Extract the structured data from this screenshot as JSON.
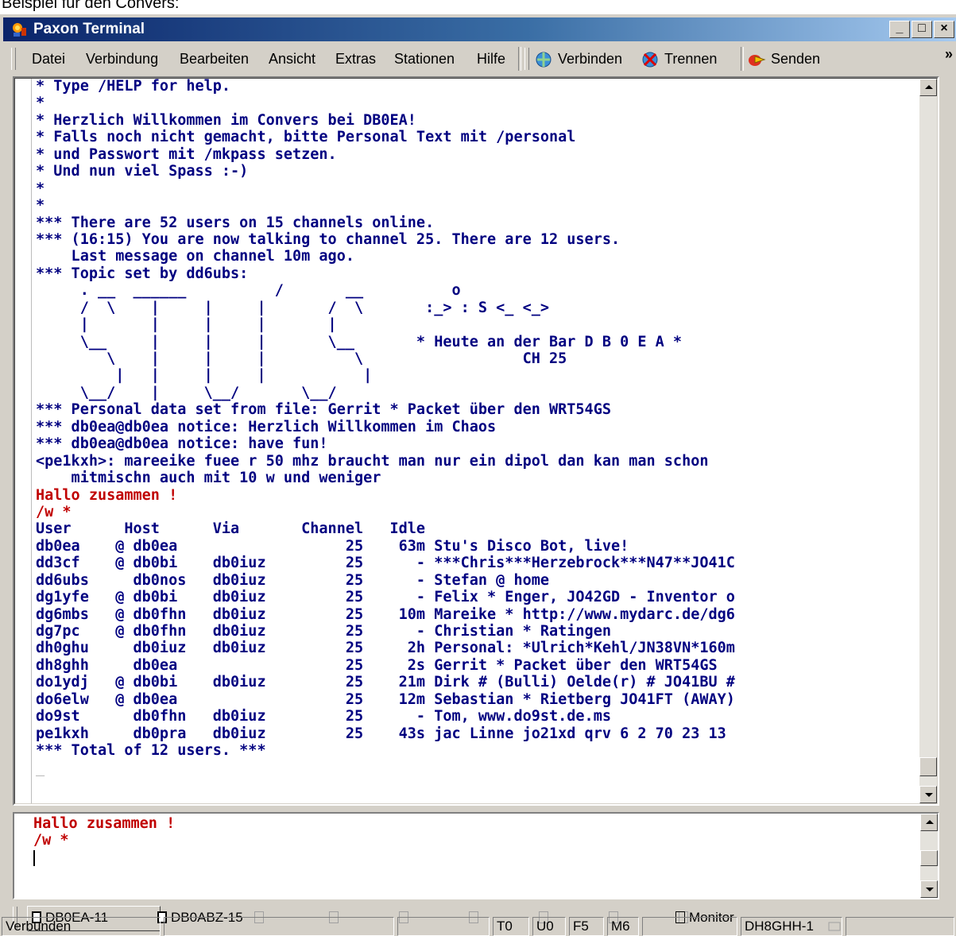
{
  "caption": "Beispiel für den Convers:",
  "window": {
    "title": "Paxon Terminal",
    "buttons": {
      "minimize": "_",
      "maximize": "□",
      "close": "×"
    }
  },
  "menu": {
    "items": [
      {
        "label": "Datei"
      },
      {
        "label": "Verbindung"
      },
      {
        "label": "Bearbeiten"
      },
      {
        "label": "Ansicht"
      },
      {
        "label": "Extras"
      },
      {
        "label": "Stationen"
      },
      {
        "label": "Hilfe"
      }
    ],
    "toolbar": [
      {
        "label": "Verbinden",
        "icon": "connect-icon"
      },
      {
        "label": "Trennen",
        "icon": "disconnect-icon"
      },
      {
        "label": "Senden",
        "icon": "send-icon"
      }
    ],
    "overflow": "»"
  },
  "terminal": {
    "lines": [
      {
        "text": "* Type /HELP for help.",
        "color": "blue"
      },
      {
        "text": "*",
        "color": "blue"
      },
      {
        "text": "* Herzlich Willkommen im Convers bei DB0EA!",
        "color": "blue"
      },
      {
        "text": "* Falls noch nicht gemacht, bitte Personal Text mit /personal",
        "color": "blue"
      },
      {
        "text": "* und Passwort mit /mkpass setzen.",
        "color": "blue"
      },
      {
        "text": "* Und nun viel Spass :-)",
        "color": "blue"
      },
      {
        "text": "*",
        "color": "blue"
      },
      {
        "text": "*",
        "color": "blue"
      },
      {
        "text": "*** There are 52 users on 15 channels online.",
        "color": "blue"
      },
      {
        "text": "*** (16:15) You are now talking to channel 25. There are 12 users.",
        "color": "blue"
      },
      {
        "text": "    Last message on channel 10m ago.",
        "color": "blue"
      },
      {
        "text": "*** Topic set by dd6ubs:",
        "color": "blue"
      },
      {
        "text": "     . __  ______          /       __          o",
        "color": "blue"
      },
      {
        "text": "     /  \\    |     |     |       /  \\       :_> : S <_ <_>",
        "color": "blue"
      },
      {
        "text": "     |       |     |     |       |",
        "color": "blue"
      },
      {
        "text": "     \\__     |     |     |       \\__       * Heute an der Bar D B 0 E A *",
        "color": "blue"
      },
      {
        "text": "        \\    |     |     |          \\                  CH 25",
        "color": "blue"
      },
      {
        "text": "         |   |     |     |           |",
        "color": "blue"
      },
      {
        "text": "     \\__/    |     \\__/       \\__/",
        "color": "blue"
      },
      {
        "text": "*** Personal data set from file: Gerrit * Packet über den WRT54GS",
        "color": "blue"
      },
      {
        "text": "*** db0ea@db0ea notice: Herzlich Willkommen im Chaos",
        "color": "blue"
      },
      {
        "text": "*** db0ea@db0ea notice: have fun!",
        "color": "blue"
      },
      {
        "text": "<pe1kxh>: mareeike fuee r 50 mhz braucht man nur ein dipol dan kan man schon",
        "color": "blue"
      },
      {
        "text": "    mitmischn auch mit 10 w und weniger",
        "color": "blue"
      },
      {
        "text": "Hallo zusammen !",
        "color": "red"
      },
      {
        "text": "/w *",
        "color": "red"
      },
      {
        "text": "User      Host      Via       Channel   Idle",
        "color": "blue"
      },
      {
        "text": "db0ea    @ db0ea                   25    63m Stu's Disco Bot, live!",
        "color": "blue"
      },
      {
        "text": "dd3cf    @ db0bi    db0iuz         25      - ***Chris***Herzebrock***N47**JO41C",
        "color": "blue"
      },
      {
        "text": "dd6ubs     db0nos   db0iuz         25      - Stefan @ home",
        "color": "blue"
      },
      {
        "text": "dg1yfe   @ db0bi    db0iuz         25      - Felix * Enger, JO42GD - Inventor o",
        "color": "blue"
      },
      {
        "text": "dg6mbs   @ db0fhn   db0iuz         25    10m Mareike * http://www.mydarc.de/dg6",
        "color": "blue"
      },
      {
        "text": "dg7pc    @ db0fhn   db0iuz         25      - Christian * Ratingen",
        "color": "blue"
      },
      {
        "text": "dh0ghu     db0iuz   db0iuz         25     2h Personal: *Ulrich*Kehl/JN38VN*160m",
        "color": "blue"
      },
      {
        "text": "dh8ghh     db0ea                   25     2s Gerrit * Packet über den WRT54GS",
        "color": "blue"
      },
      {
        "text": "do1ydj   @ db0bi    db0iuz         25    21m Dirk # (Bulli) Oelde(r) # JO41BU #",
        "color": "blue"
      },
      {
        "text": "do6elw   @ db0ea                   25    12m Sebastian * Rietberg JO41FT (AWAY)",
        "color": "blue"
      },
      {
        "text": "do9st      db0fhn   db0iuz         25      - Tom, www.do9st.de.ms",
        "color": "blue"
      },
      {
        "text": "pe1kxh     db0pra   db0iuz         25    43s jac Linne jo21xd qrv 6 2 70 23 13",
        "color": "blue"
      },
      {
        "text": "*** Total of 12 users. ***",
        "color": "blue"
      },
      {
        "text": "_",
        "color": "cursor"
      }
    ]
  },
  "input": {
    "lines": [
      "Hallo zusammen !",
      "/w *"
    ]
  },
  "tabs": [
    {
      "label": "DB0EA-11",
      "active": true
    },
    {
      "label": "DB0ABZ-15",
      "active": false
    },
    {
      "label": "",
      "active": false
    },
    {
      "label": "",
      "active": false
    },
    {
      "label": "",
      "active": false
    },
    {
      "label": "",
      "active": false
    },
    {
      "label": "",
      "active": false
    },
    {
      "label": "",
      "active": false
    },
    {
      "label": "",
      "active": false
    },
    {
      "label": "Monitor",
      "active": false
    }
  ],
  "status": {
    "state": "Verbunden",
    "t": "T0",
    "u": "U0",
    "f": "F5",
    "m": "M6",
    "callsign": "DH8GHH-1"
  },
  "colors": {
    "terminal_text": "#000080",
    "own_text": "#c00000",
    "title_start": "#0a246a",
    "title_end": "#a6caf0"
  }
}
